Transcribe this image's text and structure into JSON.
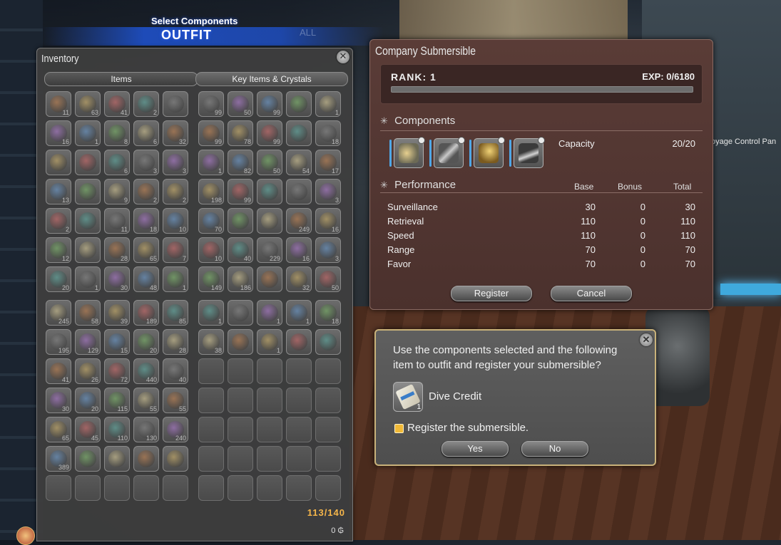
{
  "header": {
    "subtitle": "Select Components",
    "title": "OUTFIT",
    "ghost_text": "ALL"
  },
  "background": {
    "voyage_text": "oyage Control Pan"
  },
  "inventory": {
    "title": "Inventory",
    "tabs": [
      "Items",
      "Key Items & Crystals"
    ],
    "count": "113/140",
    "gil": "0"
  },
  "inventory_left_qty": [
    "11",
    "63",
    "41",
    "2",
    "",
    "16",
    "1",
    "8",
    "6",
    "32",
    "",
    "",
    "6",
    "3",
    "3",
    "13",
    "",
    "9",
    "2",
    "2",
    "2",
    "",
    "11",
    "18",
    "10",
    "12",
    "",
    "28",
    "65",
    "7",
    "20",
    "1",
    "30",
    "48",
    "1",
    "245",
    "58",
    "39",
    "189",
    "85",
    "195",
    "129",
    "15",
    "20",
    "28",
    "41",
    "26",
    "72",
    "440",
    "40",
    "30",
    "20",
    "115",
    "55",
    "55",
    "65",
    "45",
    "110",
    "130",
    "240",
    "389",
    "",
    "",
    "",
    ""
  ],
  "inventory_right_qty": [
    "99",
    "50",
    "99",
    "",
    "1",
    "99",
    "78",
    "99",
    "",
    "18",
    "1",
    "82",
    "50",
    "54",
    "17",
    "198",
    "99",
    "",
    "",
    "3",
    "70",
    "",
    "",
    "249",
    "16",
    "10",
    "40",
    "229",
    "16",
    "3",
    "149",
    "186",
    "",
    "32",
    "50",
    "1",
    "",
    "1",
    "1",
    "18",
    "38",
    "",
    "1",
    "",
    ""
  ],
  "submersible": {
    "title": "Company Submersible",
    "rank_label": "RANK:  1",
    "exp_label": "EXP: 0/6180",
    "exp_fraction": 0,
    "components_heading": "Components",
    "capacity_label": "Capacity",
    "capacity_value": "20/20",
    "performance_heading": "Performance",
    "columns": [
      "Base",
      "Bonus",
      "Total"
    ],
    "stats": [
      {
        "name": "Surveillance",
        "base": "30",
        "bonus": "0",
        "total": "30"
      },
      {
        "name": "Retrieval",
        "base": "110",
        "bonus": "0",
        "total": "110"
      },
      {
        "name": "Speed",
        "base": "110",
        "bonus": "0",
        "total": "110"
      },
      {
        "name": "Range",
        "base": "70",
        "bonus": "0",
        "total": "70"
      },
      {
        "name": "Favor",
        "base": "70",
        "bonus": "0",
        "total": "70"
      }
    ],
    "register_label": "Register",
    "cancel_label": "Cancel"
  },
  "dialog": {
    "message": "Use the components selected and the following item to outfit and register your submersible?",
    "item_name": "Dive Credit",
    "item_qty": "1",
    "checkbox_label": "Register the submersible.",
    "yes_label": "Yes",
    "no_label": "No"
  },
  "colors": {
    "accent_gold": "#f6b64a",
    "panel_brown": "#4b312d",
    "header_blue": "#1e50c8"
  }
}
